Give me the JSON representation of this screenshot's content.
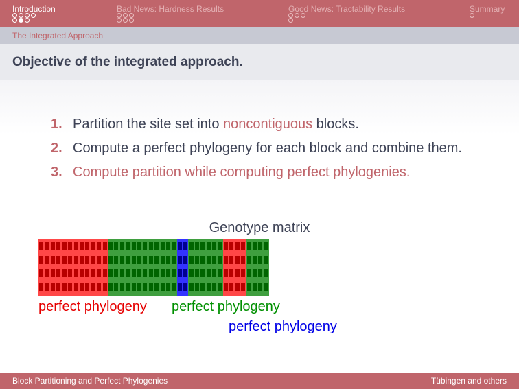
{
  "nav": {
    "sections": [
      {
        "label": "Introduction",
        "active": true,
        "dot_rows": [
          [
            false,
            false,
            false,
            false
          ],
          [
            false,
            true,
            false
          ]
        ]
      },
      {
        "label": "Bad News: Hardness Results",
        "active": false,
        "dot_rows": [
          [
            false,
            false,
            false
          ],
          [
            false,
            false,
            false
          ]
        ]
      },
      {
        "label": "Good News: Tractability Results",
        "active": false,
        "dot_rows": [
          [
            false,
            false,
            false
          ],
          [
            false
          ]
        ]
      },
      {
        "label": "Summary",
        "active": false,
        "dot_rows": [
          [
            false
          ]
        ]
      }
    ]
  },
  "subsection": "The Integrated Approach",
  "frame_title": "Objective of the integrated approach.",
  "steps": [
    {
      "num": "1.",
      "before": "Partition the site set into ",
      "highlight": "noncontiguous",
      "after": " blocks."
    },
    {
      "num": "2.",
      "text": "Compute a perfect phylogeny for each block and combine them."
    },
    {
      "num": "3.",
      "text": "Compute partition while computing perfect phylogenies."
    }
  ],
  "matrix": {
    "label": "Genotype matrix",
    "rows": 4,
    "blocks": [
      {
        "color": "red",
        "columns": 12
      },
      {
        "color": "green",
        "columns": 12
      },
      {
        "color": "blue",
        "columns": 2
      },
      {
        "color": "green",
        "columns": 6
      },
      {
        "color": "red",
        "columns": 4
      },
      {
        "color": "green",
        "columns": 4
      }
    ]
  },
  "phylogeny_labels": [
    {
      "text": "perfect phylogeny",
      "color": "red"
    },
    {
      "text": "perfect phylogeny",
      "color": "green"
    },
    {
      "text": "perfect phylogeny",
      "color": "blue"
    }
  ],
  "colors": {
    "red": {
      "bg": "#ff4747",
      "cell": "#b80000",
      "text": "#e60000"
    },
    "green": {
      "bg": "#3f9f3f",
      "cell": "#006400",
      "text": "#009000"
    },
    "blue": {
      "bg": "#3333ff",
      "cell": "#000090",
      "text": "#0000e6"
    },
    "theme": "#c0656b"
  },
  "footer": {
    "left": "Block Partitioning and Perfect Phylogenies",
    "right": "Tübingen and others"
  }
}
